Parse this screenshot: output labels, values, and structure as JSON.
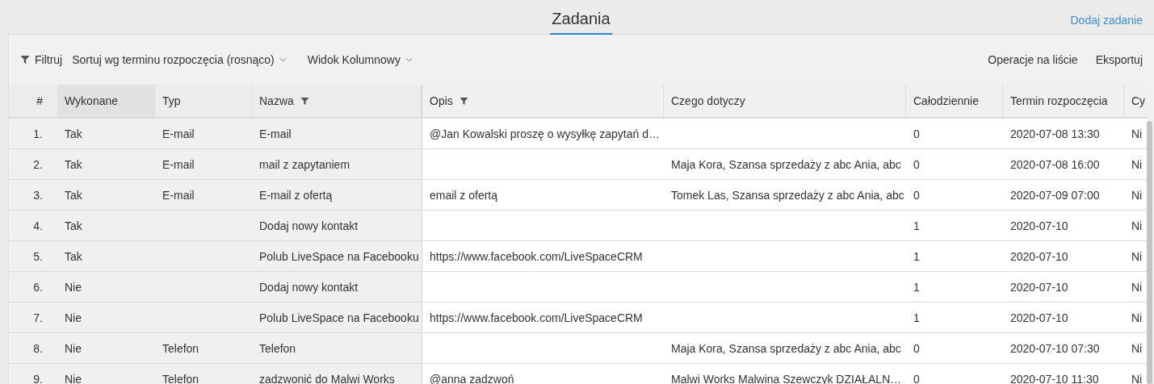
{
  "header": {
    "title": "Zadania",
    "add_link": "Dodaj zadanie"
  },
  "toolbar": {
    "filter": "Filtruj",
    "sort": "Sortuj wg terminu rozpoczęcia (rosnąco)",
    "view": "Widok Kolumnowy",
    "operations": "Operacje na liście",
    "export": "Eksportuj"
  },
  "table": {
    "columns": [
      {
        "label": "#",
        "filtered": false
      },
      {
        "label": "Wykonane",
        "filtered": false
      },
      {
        "label": "Typ",
        "filtered": false
      },
      {
        "label": "Nazwa",
        "filtered": true
      },
      {
        "label": "Opis",
        "filtered": true
      },
      {
        "label": "Czego dotyczy",
        "filtered": false
      },
      {
        "label": "Całodziennie",
        "filtered": false
      },
      {
        "label": "Termin rozpoczęcia",
        "filtered": false
      },
      {
        "label": "Cy"
      }
    ],
    "rows": [
      [
        "1.",
        "Tak",
        "E-mail",
        "E-mail",
        "@Jan Kowalski proszę o wysyłkę zapytań d…",
        "",
        "0",
        "2020-07-08 13:30",
        "Ni"
      ],
      [
        "2.",
        "Tak",
        "E-mail",
        "mail z zapytaniem",
        "",
        "Maja Kora, Szansa sprzedaży z abc Ania, abc",
        "0",
        "2020-07-08 16:00",
        "Ni"
      ],
      [
        "3.",
        "Tak",
        "E-mail",
        "E-mail z ofertą",
        "email z ofertą",
        "Tomek Las, Szansa sprzedaży z abc Ania, abc",
        "0",
        "2020-07-09 07:00",
        "Ni"
      ],
      [
        "4.",
        "Tak",
        "",
        "Dodaj nowy kontakt",
        "",
        "",
        "1",
        "2020-07-10",
        "Ni"
      ],
      [
        "5.",
        "Tak",
        "",
        "Polub LiveSpace na Facebooku",
        "https://www.facebook.com/LiveSpaceCRM",
        "",
        "1",
        "2020-07-10",
        "Ni"
      ],
      [
        "6.",
        "Nie",
        "",
        "Dodaj nowy kontakt",
        "",
        "",
        "1",
        "2020-07-10",
        "Ni"
      ],
      [
        "7.",
        "Nie",
        "",
        "Polub LiveSpace na Facebooku",
        "https://www.facebook.com/LiveSpaceCRM",
        "",
        "1",
        "2020-07-10",
        "Ni"
      ],
      [
        "8.",
        "Nie",
        "Telefon",
        "Telefon",
        "",
        "Maja Kora, Szansa sprzedaży z abc Ania, abc",
        "0",
        "2020-07-10 07:30",
        "Ni"
      ],
      [
        "9.",
        "Nie",
        "Telefon",
        "zadzwonić do Malwi Works",
        "@anna zadzwoń",
        "Malwi Works Malwina Szewczyk DZIAŁALN…",
        "0",
        "2020-07-10 11:30",
        "Ni"
      ]
    ]
  }
}
